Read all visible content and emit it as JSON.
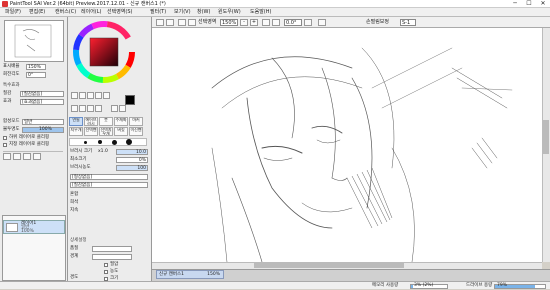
{
  "window": {
    "title": "PaintTool SAI Ver.2 (64bit) Preview.2017.12.01 - 신규 캔버스1 (*)",
    "min": "─",
    "max": "☐",
    "close": "✕"
  },
  "menu": [
    "파일(F)",
    "편집(E)",
    "캔버스(C)",
    "레이어(L)",
    "선택영역(S)",
    "필터(T)",
    "보기(V)",
    "창(W)",
    "윈도우(W)",
    "도움말(H)"
  ],
  "toolbar": {
    "select_label": "선택영역",
    "zoom": "150%",
    "zoom_minus": "-",
    "zoom_plus": "+",
    "angle": "0.0°",
    "antialias_label": "손떨림보정",
    "stabilizer": "S-1"
  },
  "navigator": {
    "zoom_label": "표시배율",
    "zoom_value": "150%",
    "angle_label": "회전각도",
    "angle_value": "0°"
  },
  "layer_props": {
    "section_label": "특수효과",
    "texture_label": "질감",
    "texture_value": "[질감없음]",
    "effect_label": "효과",
    "effect_value": "[효과없음]",
    "blend_label": "합성모드",
    "blend_value": "일반",
    "opacity_label": "불투명도",
    "opacity_value": "100%",
    "clip_label": "하위 레이어로 클리핑",
    "selsrc_label": "지정 레이어로 클리핑",
    "mask_label": "마스크",
    "mask_value": "없음"
  },
  "layers": {
    "layer_name": "레이어1",
    "layer_mode": "일반",
    "layer_opacity": "100%"
  },
  "tools": {
    "brushes": [
      "연필",
      "에어브러시",
      "붓",
      "수채화",
      "마커",
      "지우개",
      "선택펜",
      "선택지우개",
      "버킷",
      "이진펜"
    ],
    "size_label": "브러시 크기",
    "size_mult": "x1.0",
    "size_value": "10.0",
    "minsize_label": "최소크기",
    "minsize_value": "0%",
    "density_label": "브러시농도",
    "density_value": "100",
    "shape_label": "[형상없음]",
    "texture_label": "[질감없음]",
    "blend_label": "혼합",
    "dilution_label": "희석",
    "persistence_label": "지속",
    "advanced_label": "상세설정",
    "quality_label": "품질",
    "edge_label": "경계",
    "pressure_label": "압력",
    "hardness_label": "경도",
    "min_density_label": "최소농도",
    "maxpress_label": "최대필압",
    "opt1": "필압",
    "opt2": "농도",
    "opt3": "크기",
    "opt4": "혼합"
  },
  "tab": {
    "name": "신규 캔버스1",
    "zoom": "150%"
  },
  "status": {
    "memory_label": "메모리 사용량",
    "memory_value": "3% (2%)",
    "drive_label": "드라이브 용량",
    "drive_value": "79%"
  },
  "colors": {
    "foreground": "#000000",
    "background": "#ffffff",
    "accent": "#cde0f7"
  }
}
